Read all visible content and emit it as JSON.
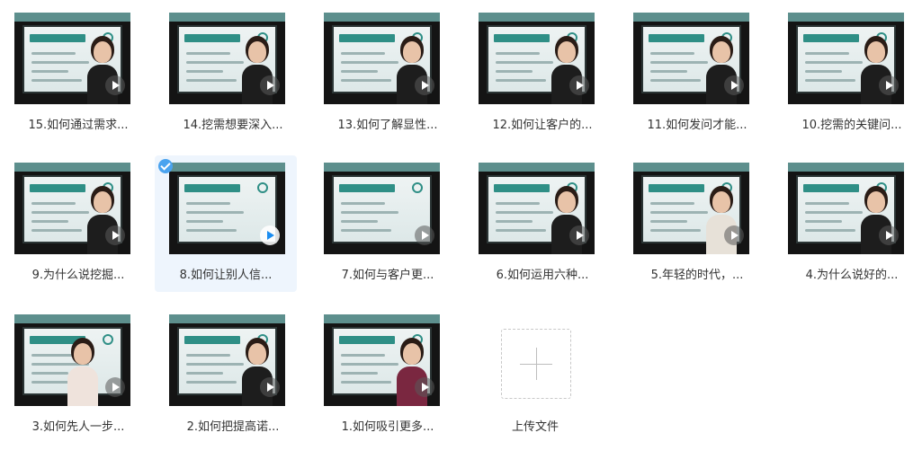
{
  "files": [
    {
      "title": "15.如何通过需求..."
    },
    {
      "title": "14.挖需想要深入..."
    },
    {
      "title": "13.如何了解显性..."
    },
    {
      "title": "12.如何让客户的..."
    },
    {
      "title": "11.如何发问才能..."
    },
    {
      "title": "10.挖需的关键问..."
    },
    {
      "title": "9.为什么说挖掘..."
    },
    {
      "title": "8.如何让别人信...",
      "selected": true
    },
    {
      "title": "7.如何与客户更..."
    },
    {
      "title": "6.如何运用六种..."
    },
    {
      "title": "5.年轻的时代，..."
    },
    {
      "title": "4.为什么说好的..."
    },
    {
      "title": "3.如何先人一步..."
    },
    {
      "title": "2.如何把提高诺..."
    },
    {
      "title": "1.如何吸引更多..."
    }
  ],
  "upload": {
    "label": "上传文件"
  },
  "colors": {
    "selected_bg": "#eef5fd",
    "accent": "#1a8cf0",
    "slide_teal": "#2f8f86"
  }
}
